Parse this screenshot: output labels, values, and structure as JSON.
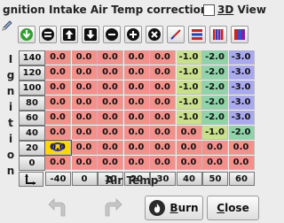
{
  "window": {
    "title": "gnition Intake Air Temp correction"
  },
  "view3d": {
    "hotkey": "3D",
    "rest": " View",
    "checked": false
  },
  "toolbar": [
    "refresh-icon",
    "decrement-icon",
    "increase-up-icon",
    "decrease-down-icon",
    "subtract-icon",
    "add-icon",
    "multiply-icon",
    "interpolate-icon",
    "smooth-icon",
    "color-bars-icon",
    "fill-icon"
  ],
  "y_axis_label": [
    "I",
    "g",
    "n",
    "i",
    "t",
    "i",
    "o",
    "n"
  ],
  "y_axis_values": [
    "140",
    "120",
    "100",
    "80",
    "60",
    "40",
    "20",
    "0"
  ],
  "x_axis_values": [
    "-40",
    "0",
    "10",
    "20",
    "30",
    "40",
    "50",
    "60"
  ],
  "x_axis_title": "Air Temp",
  "table": [
    [
      "0.0",
      "0.0",
      "0.0",
      "0.0",
      "0.0",
      "-1.0",
      "-2.0",
      "-3.0"
    ],
    [
      "0.0",
      "0.0",
      "0.0",
      "0.0",
      "0.0",
      "-1.0",
      "-2.0",
      "-3.0"
    ],
    [
      "0.0",
      "0.0",
      "0.0",
      "0.0",
      "0.0",
      "-1.0",
      "-2.0",
      "-3.0"
    ],
    [
      "0.0",
      "0.0",
      "0.0",
      "0.0",
      "0.0",
      "-1.0",
      "-2.0",
      "-3.0"
    ],
    [
      "0.0",
      "0.0",
      "0.0",
      "0.0",
      "0.0",
      "-1.0",
      "-2.0",
      "-3.0"
    ],
    [
      "0.0",
      "0.0",
      "0.0",
      "0.0",
      "0.0",
      "0.0",
      "-1.0",
      "-2.0"
    ],
    [
      "0.0",
      "0.0",
      "0.0",
      "0.0",
      "0.0",
      "0.0",
      "0.0",
      "0.0"
    ],
    [
      "0.0",
      "0.0",
      "0.0",
      "0.0",
      "0.0",
      "0.0",
      "0.0",
      "0.0"
    ]
  ],
  "colors": {
    "zero": "#f4908a",
    "neg1": "#c8e08c",
    "neg2": "#8fd3a9",
    "neg3": "#a9a9f0",
    "selected": "#ffd700"
  },
  "buttons": {
    "burn_hotkey": "B",
    "burn_rest": "urn",
    "close_hotkey": "C",
    "close_rest": "lose"
  }
}
